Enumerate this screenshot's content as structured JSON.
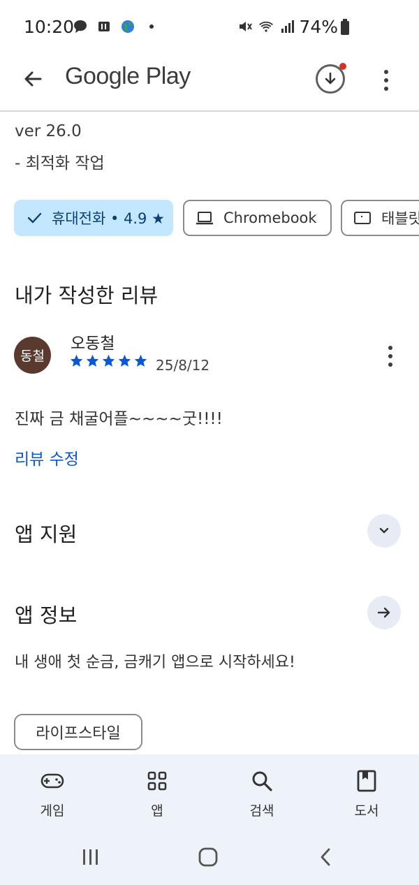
{
  "status_bar": {
    "time": "10:20",
    "battery": "74%"
  },
  "app_bar": {
    "title": "Google Play"
  },
  "version": {
    "label": "ver 26.0",
    "note": "- 최적화 작업"
  },
  "device_chips": [
    {
      "label": "휴대전화 • 4.9 ★",
      "selected": true,
      "icon": "check-icon"
    },
    {
      "label": "Chromebook",
      "selected": false,
      "icon": "laptop-icon"
    },
    {
      "label": "태블릿",
      "selected": false,
      "icon": "tablet-icon"
    }
  ],
  "my_review": {
    "heading": "내가 작성한 리뷰",
    "avatar_text": "동철",
    "reviewer": "오동철",
    "rating": 5,
    "date": "25/8/12",
    "text": "진짜 금 채굴어플~~~~굿!!!!",
    "edit_label": "리뷰 수정"
  },
  "app_support": {
    "heading": "앱 지원"
  },
  "app_info": {
    "heading": "앱 정보",
    "description": "내 생애 첫 순금, 금캐기 앱으로 시작하세요!",
    "tag": "라이프스타일"
  },
  "bottom_nav": [
    {
      "label": "게임",
      "icon": "gamepad-icon"
    },
    {
      "label": "앱",
      "icon": "apps-grid-icon"
    },
    {
      "label": "검색",
      "icon": "search-icon"
    },
    {
      "label": "도서",
      "icon": "book-icon"
    }
  ],
  "colors": {
    "accent": "#0b57d0",
    "chip_selected": "#c2e7ff",
    "nav_bg": "#eef2f9",
    "avatar_bg": "#5a3a2e"
  }
}
